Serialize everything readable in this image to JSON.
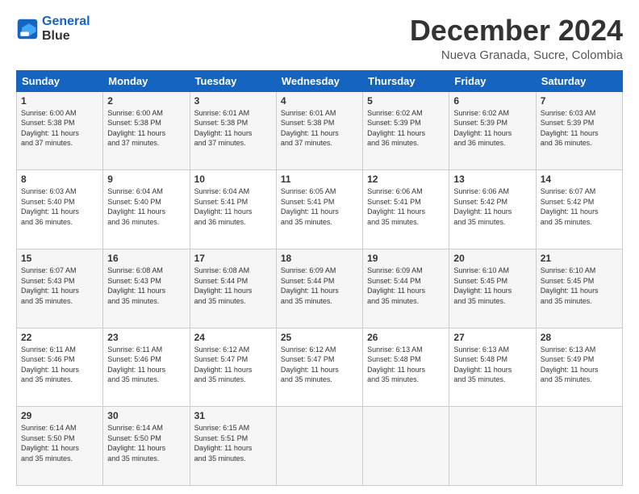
{
  "logo": {
    "line1": "General",
    "line2": "Blue"
  },
  "title": "December 2024",
  "subtitle": "Nueva Granada, Sucre, Colombia",
  "days_header": [
    "Sunday",
    "Monday",
    "Tuesday",
    "Wednesday",
    "Thursday",
    "Friday",
    "Saturday"
  ],
  "weeks": [
    [
      {
        "day": "1",
        "info": "Sunrise: 6:00 AM\nSunset: 5:38 PM\nDaylight: 11 hours\nand 37 minutes."
      },
      {
        "day": "2",
        "info": "Sunrise: 6:00 AM\nSunset: 5:38 PM\nDaylight: 11 hours\nand 37 minutes."
      },
      {
        "day": "3",
        "info": "Sunrise: 6:01 AM\nSunset: 5:38 PM\nDaylight: 11 hours\nand 37 minutes."
      },
      {
        "day": "4",
        "info": "Sunrise: 6:01 AM\nSunset: 5:38 PM\nDaylight: 11 hours\nand 37 minutes."
      },
      {
        "day": "5",
        "info": "Sunrise: 6:02 AM\nSunset: 5:39 PM\nDaylight: 11 hours\nand 36 minutes."
      },
      {
        "day": "6",
        "info": "Sunrise: 6:02 AM\nSunset: 5:39 PM\nDaylight: 11 hours\nand 36 minutes."
      },
      {
        "day": "7",
        "info": "Sunrise: 6:03 AM\nSunset: 5:39 PM\nDaylight: 11 hours\nand 36 minutes."
      }
    ],
    [
      {
        "day": "8",
        "info": "Sunrise: 6:03 AM\nSunset: 5:40 PM\nDaylight: 11 hours\nand 36 minutes."
      },
      {
        "day": "9",
        "info": "Sunrise: 6:04 AM\nSunset: 5:40 PM\nDaylight: 11 hours\nand 36 minutes."
      },
      {
        "day": "10",
        "info": "Sunrise: 6:04 AM\nSunset: 5:41 PM\nDaylight: 11 hours\nand 36 minutes."
      },
      {
        "day": "11",
        "info": "Sunrise: 6:05 AM\nSunset: 5:41 PM\nDaylight: 11 hours\nand 35 minutes."
      },
      {
        "day": "12",
        "info": "Sunrise: 6:06 AM\nSunset: 5:41 PM\nDaylight: 11 hours\nand 35 minutes."
      },
      {
        "day": "13",
        "info": "Sunrise: 6:06 AM\nSunset: 5:42 PM\nDaylight: 11 hours\nand 35 minutes."
      },
      {
        "day": "14",
        "info": "Sunrise: 6:07 AM\nSunset: 5:42 PM\nDaylight: 11 hours\nand 35 minutes."
      }
    ],
    [
      {
        "day": "15",
        "info": "Sunrise: 6:07 AM\nSunset: 5:43 PM\nDaylight: 11 hours\nand 35 minutes."
      },
      {
        "day": "16",
        "info": "Sunrise: 6:08 AM\nSunset: 5:43 PM\nDaylight: 11 hours\nand 35 minutes."
      },
      {
        "day": "17",
        "info": "Sunrise: 6:08 AM\nSunset: 5:44 PM\nDaylight: 11 hours\nand 35 minutes."
      },
      {
        "day": "18",
        "info": "Sunrise: 6:09 AM\nSunset: 5:44 PM\nDaylight: 11 hours\nand 35 minutes."
      },
      {
        "day": "19",
        "info": "Sunrise: 6:09 AM\nSunset: 5:44 PM\nDaylight: 11 hours\nand 35 minutes."
      },
      {
        "day": "20",
        "info": "Sunrise: 6:10 AM\nSunset: 5:45 PM\nDaylight: 11 hours\nand 35 minutes."
      },
      {
        "day": "21",
        "info": "Sunrise: 6:10 AM\nSunset: 5:45 PM\nDaylight: 11 hours\nand 35 minutes."
      }
    ],
    [
      {
        "day": "22",
        "info": "Sunrise: 6:11 AM\nSunset: 5:46 PM\nDaylight: 11 hours\nand 35 minutes."
      },
      {
        "day": "23",
        "info": "Sunrise: 6:11 AM\nSunset: 5:46 PM\nDaylight: 11 hours\nand 35 minutes."
      },
      {
        "day": "24",
        "info": "Sunrise: 6:12 AM\nSunset: 5:47 PM\nDaylight: 11 hours\nand 35 minutes."
      },
      {
        "day": "25",
        "info": "Sunrise: 6:12 AM\nSunset: 5:47 PM\nDaylight: 11 hours\nand 35 minutes."
      },
      {
        "day": "26",
        "info": "Sunrise: 6:13 AM\nSunset: 5:48 PM\nDaylight: 11 hours\nand 35 minutes."
      },
      {
        "day": "27",
        "info": "Sunrise: 6:13 AM\nSunset: 5:48 PM\nDaylight: 11 hours\nand 35 minutes."
      },
      {
        "day": "28",
        "info": "Sunrise: 6:13 AM\nSunset: 5:49 PM\nDaylight: 11 hours\nand 35 minutes."
      }
    ],
    [
      {
        "day": "29",
        "info": "Sunrise: 6:14 AM\nSunset: 5:50 PM\nDaylight: 11 hours\nand 35 minutes."
      },
      {
        "day": "30",
        "info": "Sunrise: 6:14 AM\nSunset: 5:50 PM\nDaylight: 11 hours\nand 35 minutes."
      },
      {
        "day": "31",
        "info": "Sunrise: 6:15 AM\nSunset: 5:51 PM\nDaylight: 11 hours\nand 35 minutes."
      },
      {
        "day": "",
        "info": ""
      },
      {
        "day": "",
        "info": ""
      },
      {
        "day": "",
        "info": ""
      },
      {
        "day": "",
        "info": ""
      }
    ]
  ]
}
